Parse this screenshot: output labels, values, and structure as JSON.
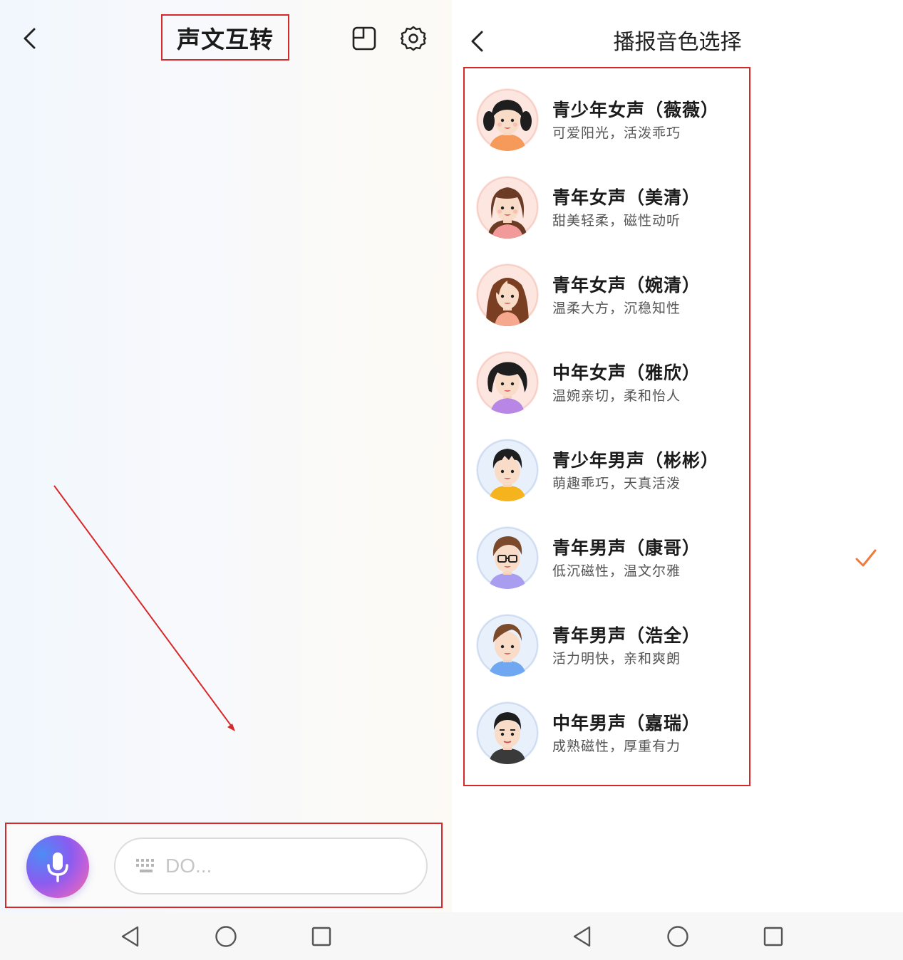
{
  "left": {
    "title": "声文互转",
    "input_placeholder": "DO..."
  },
  "right": {
    "title": "播报音色选择",
    "voices": [
      {
        "name": "青少年女声（薇薇）",
        "desc": "可爱阳光，活泼乖巧",
        "selected": false
      },
      {
        "name": "青年女声（美清）",
        "desc": "甜美轻柔，磁性动听",
        "selected": false
      },
      {
        "name": "青年女声（婉清）",
        "desc": "温柔大方，沉稳知性",
        "selected": false
      },
      {
        "name": "中年女声（雅欣）",
        "desc": "温婉亲切，柔和怡人",
        "selected": false
      },
      {
        "name": "青少年男声（彬彬）",
        "desc": "萌趣乖巧，天真活泼",
        "selected": false
      },
      {
        "name": "青年男声（康哥）",
        "desc": "低沉磁性，温文尔雅",
        "selected": true
      },
      {
        "name": "青年男声（浩全）",
        "desc": "活力明快，亲和爽朗",
        "selected": false
      },
      {
        "name": "中年男声（嘉瑞）",
        "desc": "成熟磁性，厚重有力",
        "selected": false
      }
    ]
  },
  "colors": {
    "accent_check": "#f07a3c",
    "annotation_red": "#d62a2a"
  }
}
